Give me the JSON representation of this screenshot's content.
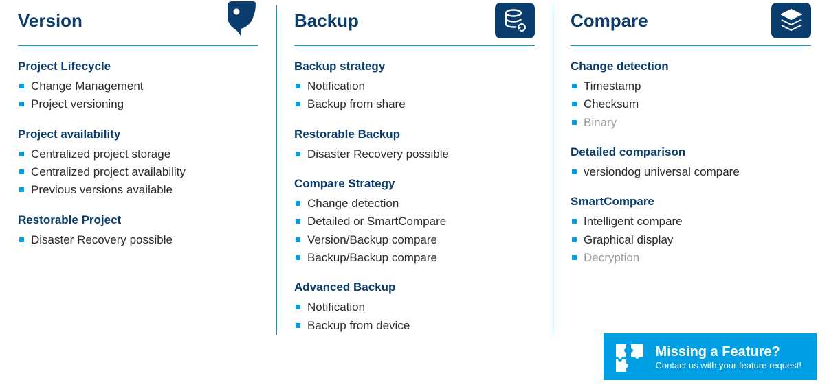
{
  "columns": [
    {
      "title": "Version",
      "icon": "version-icon",
      "sections": [
        {
          "title": "Project Lifecycle",
          "items": [
            {
              "label": "Change Management",
              "dim": false
            },
            {
              "label": "Project versioning",
              "dim": false
            }
          ]
        },
        {
          "title": "Project availability",
          "items": [
            {
              "label": "Centralized project storage",
              "dim": false
            },
            {
              "label": "Centralized project availability",
              "dim": false
            },
            {
              "label": "Previous versions available",
              "dim": false
            }
          ]
        },
        {
          "title": "Restorable Project",
          "items": [
            {
              "label": "Disaster Recovery possible",
              "dim": false
            }
          ]
        }
      ]
    },
    {
      "title": "Backup",
      "icon": "backup-icon",
      "sections": [
        {
          "title": "Backup strategy",
          "items": [
            {
              "label": "Notification",
              "dim": false
            },
            {
              "label": "Backup from share",
              "dim": false
            }
          ]
        },
        {
          "title": "Restorable Backup",
          "items": [
            {
              "label": "Disaster Recovery possible",
              "dim": false
            }
          ]
        },
        {
          "title": "Compare Strategy",
          "items": [
            {
              "label": "Change detection",
              "dim": false
            },
            {
              "label": "Detailed or SmartCompare",
              "dim": false
            },
            {
              "label": "Version/Backup compare",
              "dim": false
            },
            {
              "label": "Backup/Backup compare",
              "dim": false
            }
          ]
        },
        {
          "title": "Advanced Backup",
          "items": [
            {
              "label": "Notification",
              "dim": false
            },
            {
              "label": "Backup from device",
              "dim": false
            }
          ]
        }
      ]
    },
    {
      "title": "Compare",
      "icon": "compare-icon",
      "sections": [
        {
          "title": "Change detection",
          "items": [
            {
              "label": "Timestamp",
              "dim": false
            },
            {
              "label": "Checksum",
              "dim": false
            },
            {
              "label": "Binary",
              "dim": true
            }
          ]
        },
        {
          "title": "Detailed comparison",
          "items": [
            {
              "label": "versiondog universal compare",
              "dim": false
            }
          ]
        },
        {
          "title": "SmartCompare",
          "items": [
            {
              "label": "Intelligent compare",
              "dim": false
            },
            {
              "label": "Graphical display",
              "dim": false
            },
            {
              "label": "Decryption",
              "dim": true
            }
          ]
        }
      ]
    }
  ],
  "banner": {
    "title": "Missing a Feature?",
    "subtitle": "Contact us with your feature request!"
  }
}
